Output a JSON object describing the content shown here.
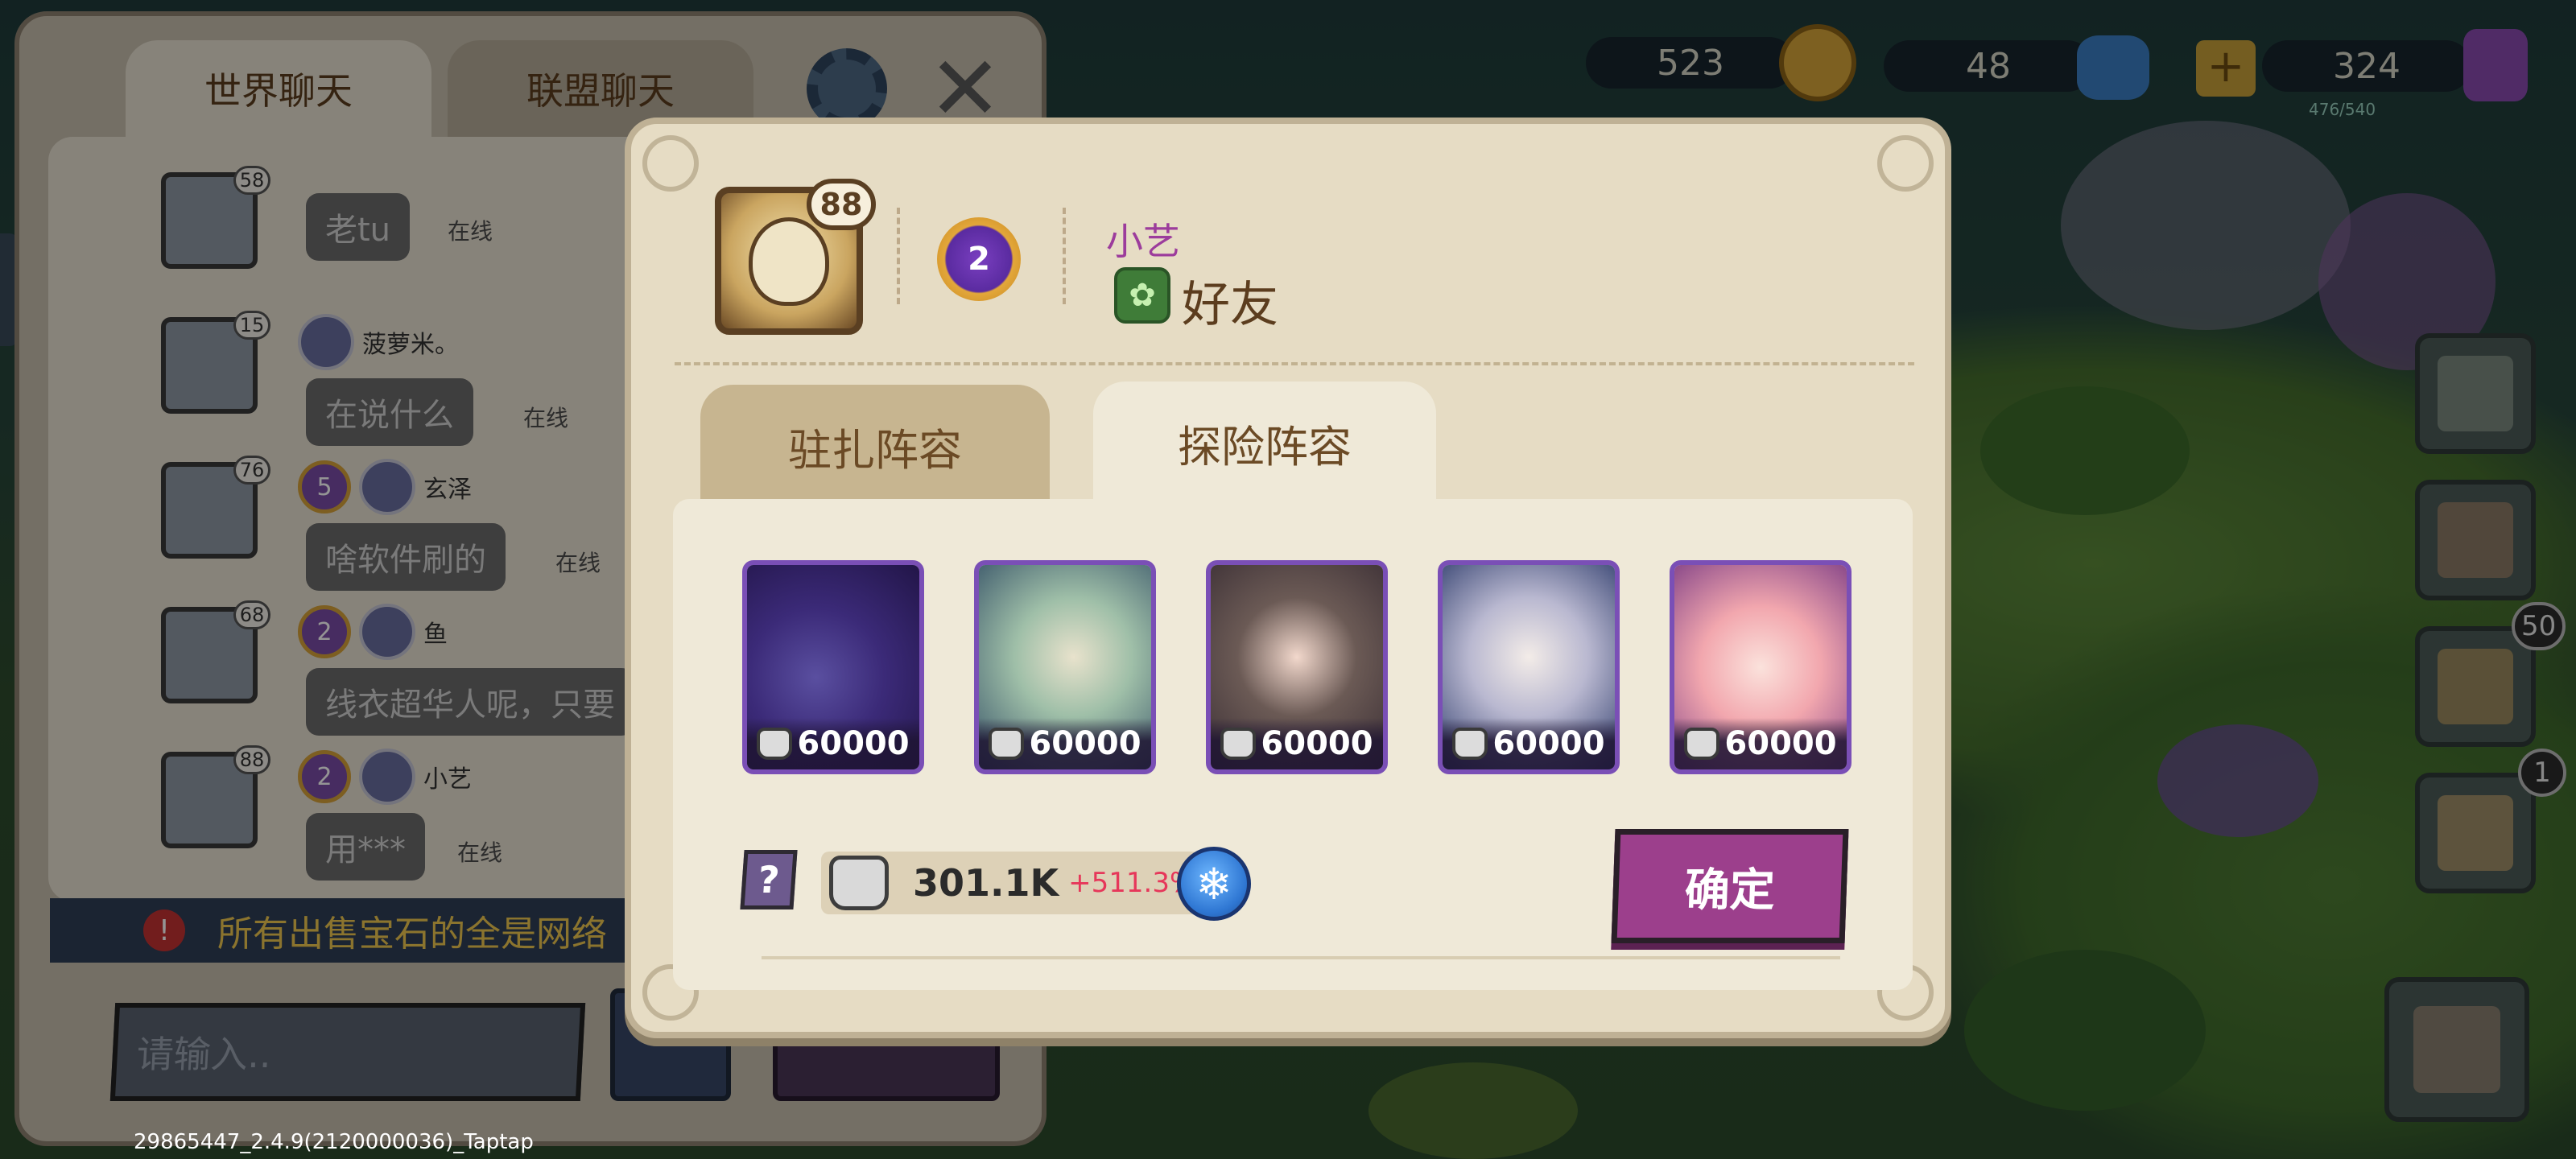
{
  "hud": {
    "gold": "523",
    "gems": "48",
    "energy": "324",
    "energy_detail": "476/540",
    "side_badge_1": "50",
    "side_badge_2": "1"
  },
  "chat": {
    "tabs": [
      "世界聊天",
      "联盟聊天"
    ],
    "messages": [
      {
        "level": "58",
        "vip": "",
        "nick": "",
        "text": "老tu",
        "status": "在线"
      },
      {
        "level": "15",
        "vip": "",
        "nick": "菠萝米。",
        "text": "在说什么",
        "status": "在线"
      },
      {
        "level": "76",
        "vip": "5",
        "nick": "玄泽",
        "text": "啥软件刷的",
        "status": "在线"
      },
      {
        "level": "68",
        "vip": "2",
        "nick": "鱼",
        "text": "线衣超华人呢，只要",
        "status": ""
      },
      {
        "level": "88",
        "vip": "2",
        "nick": "小艺",
        "text": "用***",
        "status": "在线"
      }
    ],
    "notice": "所有出售宝石的全是网络",
    "input_placeholder": "请输入.."
  },
  "dialog": {
    "avatar_level": "88",
    "vip_level": "2",
    "player_name": "小艺",
    "relation_label": "好友",
    "tabs": [
      "驻扎阵容",
      "探险阵容"
    ],
    "active_tab": "探险阵容",
    "heroes": [
      {
        "name": "shadow-dragon",
        "power": "60000"
      },
      {
        "name": "white-serpent",
        "power": "60000"
      },
      {
        "name": "fox-girl",
        "power": "60000"
      },
      {
        "name": "silver-hair-girl",
        "power": "60000"
      },
      {
        "name": "pink-hair-girl",
        "power": "60000"
      }
    ],
    "help_label": "?",
    "total_power": "301.1K",
    "power_bonus": "+511.3%",
    "confirm_label": "确定"
  },
  "footer": {
    "version": "29865447_2.4.9(2120000036)_Taptap"
  },
  "colors": {
    "dialog_bg": "#e6dcc4",
    "hero_border": "#7a4fb6",
    "confirm_button": "#9c3f8c",
    "player_name": "#9c3c9c",
    "bonus_text": "#e6375a"
  }
}
